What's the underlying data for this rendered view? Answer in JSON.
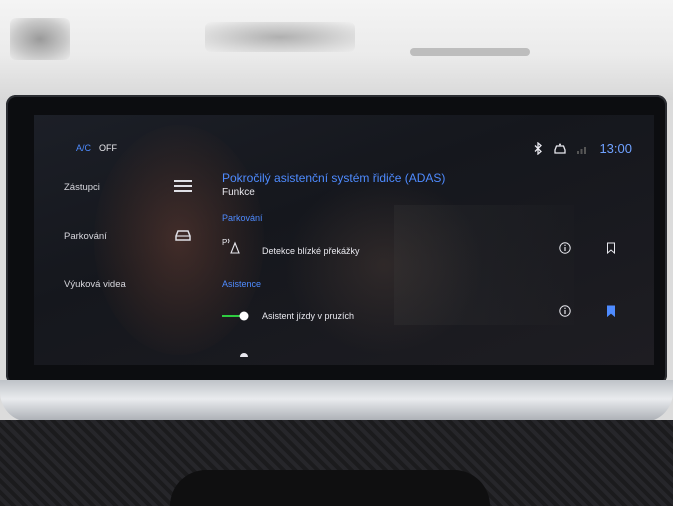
{
  "status_bar": {
    "time": "13:00",
    "icons": [
      "bluetooth-icon",
      "car-connect-icon",
      "signal-icon"
    ]
  },
  "climate": {
    "ac_label": "A/C",
    "ac_state": "OFF"
  },
  "shortcuts": [
    {
      "label": "Zástupci"
    },
    {
      "label": "Parkování"
    },
    {
      "label": "Výuková videa"
    }
  ],
  "page": {
    "title": "Pokročilý asistenční systém řidiče (ADAS)",
    "subtitle": "Funkce"
  },
  "sections": [
    {
      "label": "Parkování",
      "rows": [
        {
          "icon": "parking-sensor-icon",
          "label": "Detekce blízké překážky",
          "bookmarked": false
        }
      ]
    },
    {
      "label": "Asistence",
      "rows": [
        {
          "icon": "lane-keeping-icon",
          "label": "Asistent jízdy v pruzích",
          "bookmarked": true
        }
      ]
    }
  ],
  "colors": {
    "accent": "#4e8bff",
    "toggle_on": "#2ecc40",
    "screen_bg": "#181a20"
  }
}
